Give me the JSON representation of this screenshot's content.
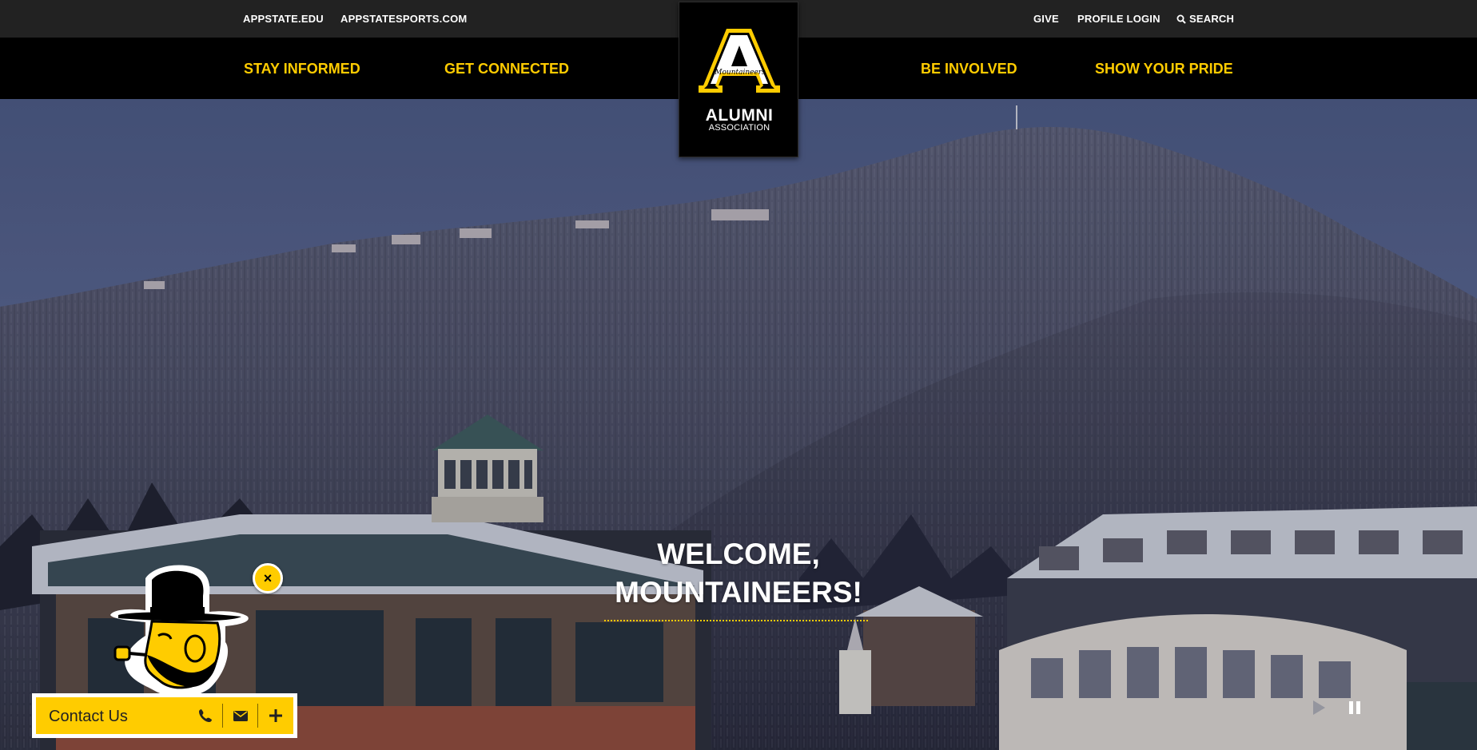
{
  "utility_nav": {
    "left_links": [
      "APPSTATE.EDU",
      "APPSTATESPORTS.COM"
    ],
    "right_links": [
      "GIVE",
      "PROFILE LOGIN"
    ],
    "search_label": "SEARCH"
  },
  "main_nav": {
    "items": [
      "STAY INFORMED",
      "GET CONNECTED",
      "BE INVOLVED",
      "SHOW YOUR PRIDE"
    ]
  },
  "logo": {
    "letter": "A",
    "script": "Mountaineers",
    "line1": "ALUMNI",
    "line2": "ASSOCIATION"
  },
  "hero": {
    "title_line1": "WELCOME,",
    "title_line2": "MOUNTAINEERS!"
  },
  "contact": {
    "label": "Contact Us",
    "icons": [
      "phone-icon",
      "envelope-icon",
      "plus-icon"
    ],
    "close_symbol": "×"
  },
  "video_controls": [
    "play-icon",
    "pause-icon"
  ],
  "colors": {
    "accent": "#ffcc00",
    "nav_bg": "#000000",
    "util_bg": "#222222",
    "text_light": "#ffffff"
  }
}
